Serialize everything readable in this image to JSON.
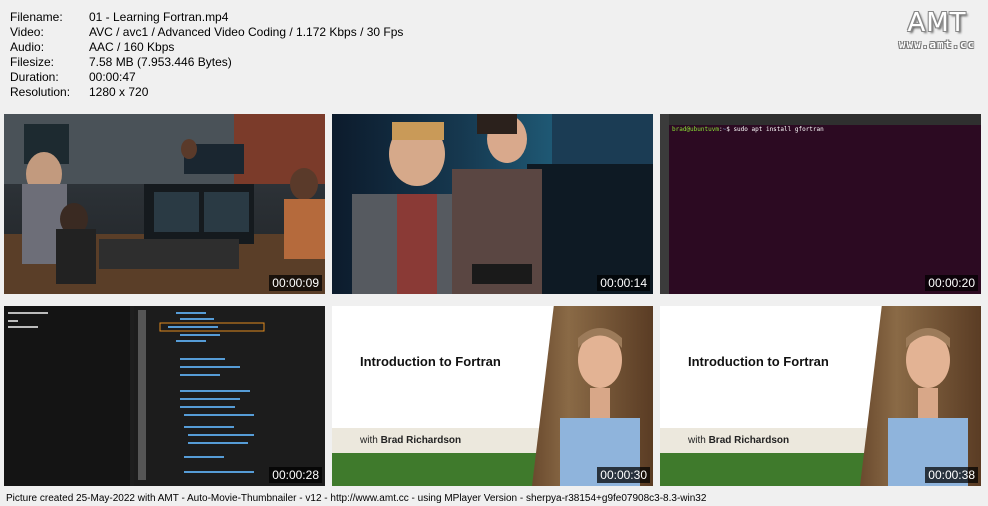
{
  "meta": {
    "rows": [
      {
        "key": "Filename:",
        "value": "01 - Learning Fortran.mp4"
      },
      {
        "key": "Video:",
        "value": "AVC / avc1 / Advanced Video Coding / 1.172 Kbps / 30 Fps"
      },
      {
        "key": "Audio:",
        "value": "AAC / 160 Kbps"
      },
      {
        "key": "Filesize:",
        "value": "7.58 MB (7.953.446 Bytes)"
      },
      {
        "key": "Duration:",
        "value": "00:00:47"
      },
      {
        "key": "Resolution:",
        "value": "1280 x 720"
      }
    ]
  },
  "logo": {
    "big": "AMT",
    "small": "www.amt.cc"
  },
  "thumbs": [
    {
      "time": "00:00:09"
    },
    {
      "time": "00:00:14"
    },
    {
      "time": "00:00:20",
      "user": "brad@ubuntuvm",
      "path": "~",
      "command": "$ sudo apt install gfortran"
    },
    {
      "time": "00:00:28"
    },
    {
      "time": "00:00:30",
      "title": "Introduction to Fortran",
      "with": "with",
      "presenter": "Brad Richardson"
    },
    {
      "time": "00:00:38",
      "title": "Introduction to Fortran",
      "with": "with",
      "presenter": "Brad Richardson"
    }
  ],
  "footer": "Picture created 25-May-2022 with AMT - Auto-Movie-Thumbnailer - v12 - http://www.amt.cc - using MPlayer Version - sherpya-r38154+g9fe07908c3-8.3-win32",
  "colors": {
    "background": "#f0f0f0",
    "terminal": "#2c0a22",
    "slide_green": "#3f7a2c",
    "highlight": "#e08a1e"
  }
}
